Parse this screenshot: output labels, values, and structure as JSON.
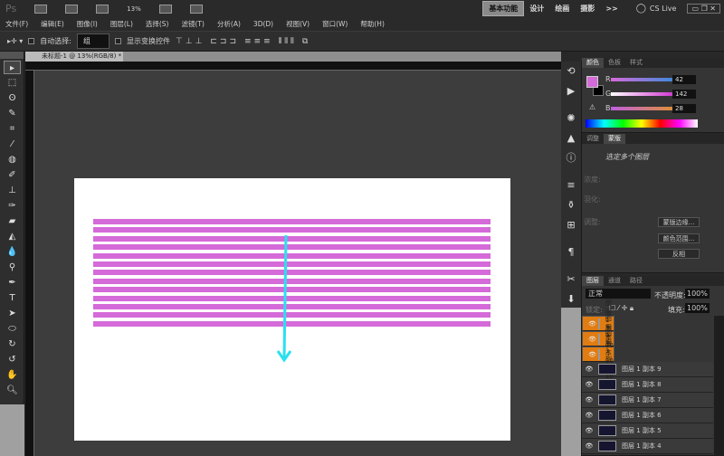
{
  "app": {
    "logo": "Ps",
    "zoom": "13%",
    "workspaces": [
      "基本功能",
      "设计",
      "绘画",
      "摄影"
    ],
    "more": ">>",
    "cslive": "CS Live"
  },
  "menu": [
    "文件(F)",
    "编辑(E)",
    "图像(I)",
    "图层(L)",
    "选择(S)",
    "滤镜(T)",
    "分析(A)",
    "3D(D)",
    "视图(V)",
    "窗口(W)",
    "帮助(H)"
  ],
  "options": {
    "auto_select": "自动选择:",
    "auto_select_value": "组",
    "show_transform": "显示变换控件"
  },
  "document": {
    "tab": "未标题-1 @ 13%(RGB/8) *",
    "stripe_count": 13,
    "stripe_color": "#d56ad9",
    "arrow_color": "#29e0f0"
  },
  "color_panel": {
    "tabs": [
      "颜色",
      "色板",
      "样式"
    ],
    "r_label": "R",
    "g_label": "G",
    "b_label": "B",
    "r": "42",
    "g": "142",
    "b": "28",
    "fg": "#d56ad9"
  },
  "mask_panel": {
    "tabs": [
      "调整",
      "蒙版"
    ],
    "title": "选定多个图层",
    "density": "浓度:",
    "feather": "羽化:",
    "refine": "调整:",
    "buttons": [
      "蒙版边缘...",
      "颜色范围...",
      "反相"
    ]
  },
  "layers_panel": {
    "tabs": [
      "图层",
      "通道",
      "路径"
    ],
    "blend": "正常",
    "opacity_label": "不透明度:",
    "opacity": "100%",
    "lock_label": "锁定:",
    "fill_label": "填充:",
    "fill": "100%",
    "layers": [
      {
        "name": "图层 1 副本 10",
        "selected": true
      },
      {
        "name": "图层 1 副本 10",
        "selected": true
      },
      {
        "name": "图层 1 副本 10",
        "selected": true
      },
      {
        "name": "图层 1 副本 9",
        "selected": false
      },
      {
        "name": "图层 1 副本 8",
        "selected": false
      },
      {
        "name": "图层 1 副本 7",
        "selected": false
      },
      {
        "name": "图层 1 副本 6",
        "selected": false
      },
      {
        "name": "图层 1 副本 5",
        "selected": false
      },
      {
        "name": "图层 1 副本 4",
        "selected": false
      }
    ]
  }
}
